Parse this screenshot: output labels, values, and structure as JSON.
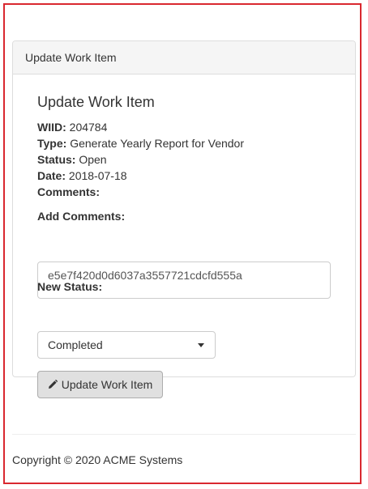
{
  "panel": {
    "heading": "Update Work Item"
  },
  "item": {
    "title": "Update Work Item",
    "wiid_label": "WIID:",
    "wiid_value": "204784",
    "type_label": "Type:",
    "type_value": "Generate Yearly Report for Vendor",
    "status_label": "Status:",
    "status_value": "Open",
    "date_label": "Date:",
    "date_value": "2018-07-18",
    "comments_label": "Comments:"
  },
  "form": {
    "add_comments_label": "Add Comments:",
    "add_comments_value": "e5e7f420d0d6037a3557721cdcfd555a",
    "new_status_label": "New Status:",
    "new_status_selected": "Completed",
    "submit_label": "Update Work Item",
    "submit_icon": "pencil-icon"
  },
  "footer": {
    "copyright": "Copyright © 2020 ACME Systems"
  },
  "colors": {
    "frame_border": "#d9282f",
    "panel_heading_bg": "#f5f5f5",
    "button_bg": "#e0e0e0"
  }
}
